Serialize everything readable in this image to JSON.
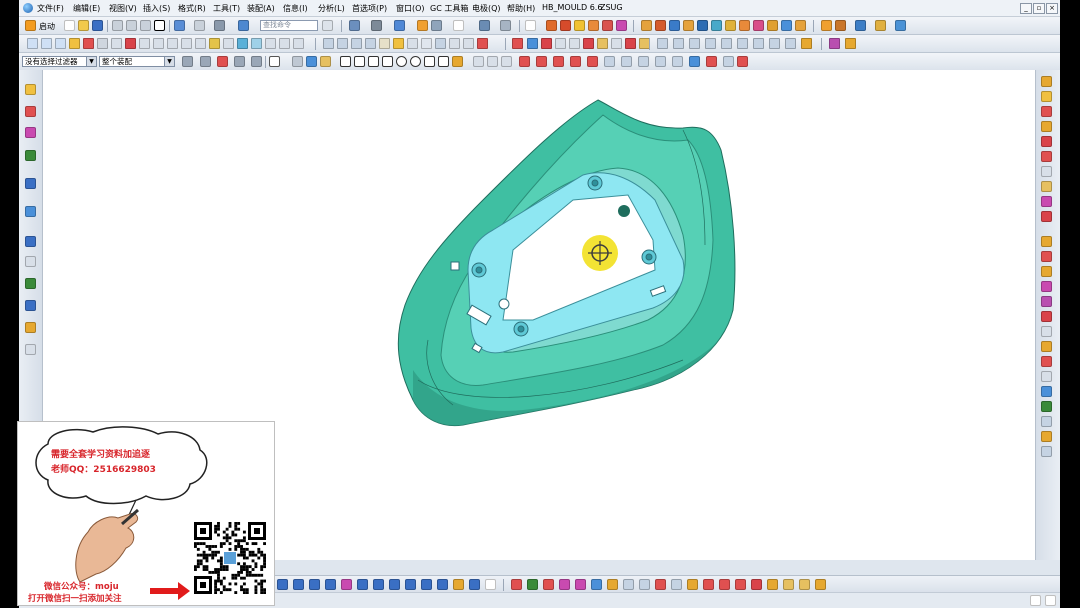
{
  "menu": {
    "items": [
      "文件(F)",
      "编辑(E)",
      "视图(V)",
      "插入(S)",
      "格式(R)",
      "工具(T)",
      "装配(A)",
      "信息(I)",
      "分析(L)",
      "首选项(P)",
      "窗口(O)",
      "GC 工具箱",
      "电极(Q)",
      "帮助(H)",
      "HB_MOULD 6.6",
      "ZSUG"
    ]
  },
  "toolbar": {
    "start_label": "启动",
    "search_placeholder": "查找命令"
  },
  "filter": {
    "selection_filter": "没有选择过滤器",
    "assembly_scope": "整个装配"
  },
  "promo": {
    "bubble_line1": "需要全套学习资料加追逐",
    "bubble_line2": "老师QQ：2516629803",
    "wechat_line1": "微信公众号：moju",
    "wechat_line2": "打开微信扫一扫添加关注"
  },
  "colors": {
    "part": "#3fbfa2",
    "part_face": "#8ee7f2",
    "marker": "#f3e22a",
    "promo_text": "#d8252b"
  }
}
